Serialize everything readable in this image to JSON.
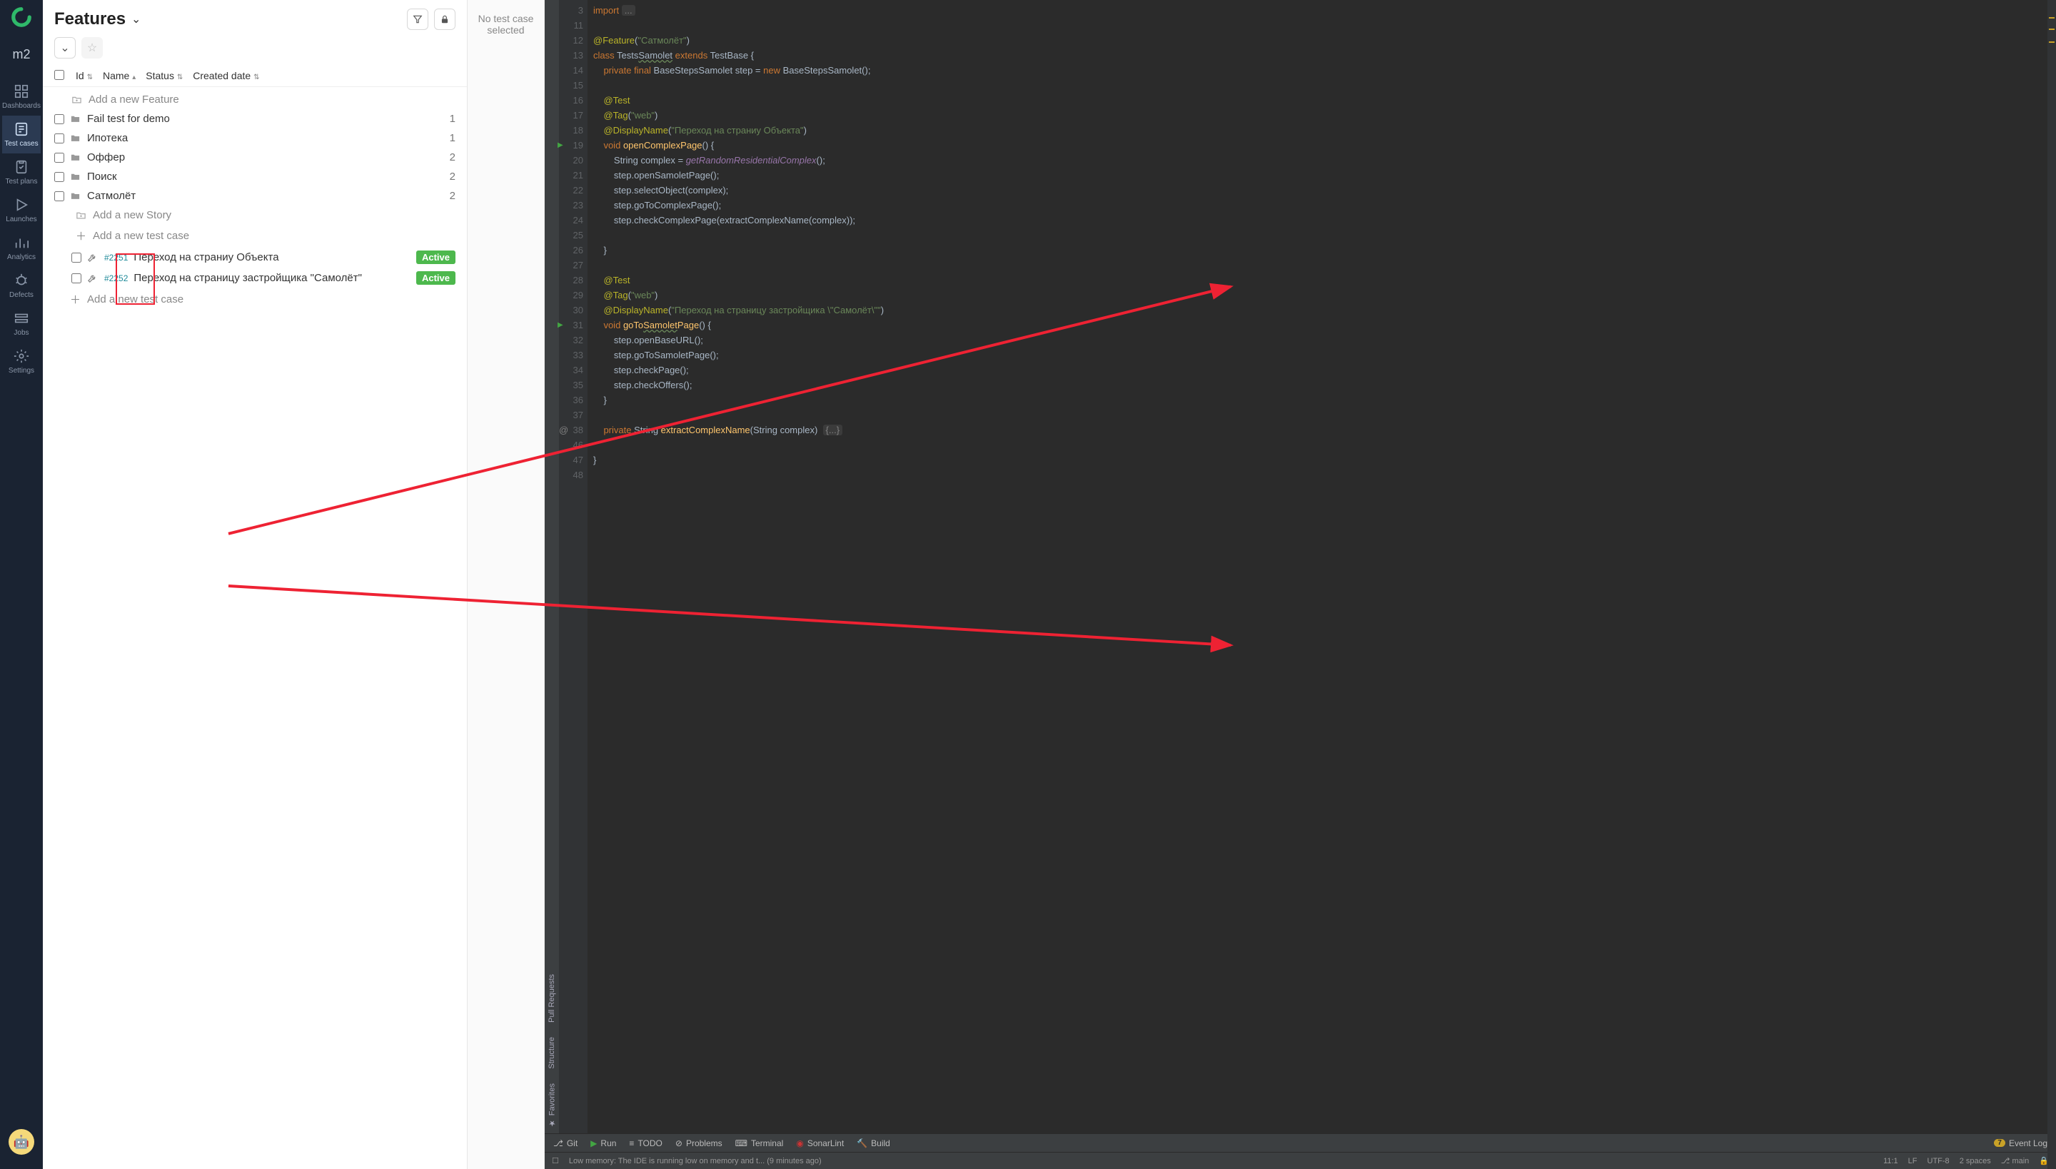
{
  "project": "m2",
  "nav": [
    {
      "key": "dashboards",
      "label": "Dashboards"
    },
    {
      "key": "testcases",
      "label": "Test cases"
    },
    {
      "key": "testplans",
      "label": "Test plans"
    },
    {
      "key": "launches",
      "label": "Launches"
    },
    {
      "key": "analytics",
      "label": "Analytics"
    },
    {
      "key": "defects",
      "label": "Defects"
    },
    {
      "key": "jobs",
      "label": "Jobs"
    },
    {
      "key": "settings",
      "label": "Settings"
    }
  ],
  "left_panel": {
    "title": "Features",
    "columns": {
      "id": "Id",
      "name": "Name",
      "status": "Status",
      "created": "Created date"
    },
    "add_feature": "Add a new Feature",
    "add_story": "Add a new Story",
    "add_testcase": "Add a new test case",
    "rows": [
      {
        "label": "Fail test for demo",
        "count": "1"
      },
      {
        "label": "Ипотека",
        "count": "1"
      },
      {
        "label": "Оффер",
        "count": "2"
      },
      {
        "label": "Поиск",
        "count": "2"
      },
      {
        "label": "Сатмолёт",
        "count": "2"
      }
    ],
    "testcases": [
      {
        "id": "#2251",
        "title": "Переход на страниу Объекта",
        "status": "Active"
      },
      {
        "id": "#2252",
        "title": "Переход на страницу застройщика \"Самолёт\"",
        "status": "Active"
      }
    ]
  },
  "mid_message": "No test case selected",
  "ide": {
    "left_tabs": {
      "pull": "Pull Requests",
      "structure": "Structure",
      "favorites": "Favorites"
    },
    "code_lines": [
      {
        "n": 3,
        "html": "<span class='tok-kw'>import</span> <span class='code-fold'>...</span>"
      },
      {
        "n": 11,
        "html": ""
      },
      {
        "n": 12,
        "html": "<span class='tok-ann'>@Feature</span>(<span class='tok-str'>\"Сатмолёт\"</span>)"
      },
      {
        "n": 13,
        "html": "<span class='tok-kw'>class</span> Tests<span style='text-decoration:underline wavy #6a8759'>Samolet</span> <span class='tok-kw'>extends</span> TestBase {"
      },
      {
        "n": 14,
        "html": "    <span class='tok-kw'>private final</span> BaseStepsSamolet step = <span class='tok-kw'>new</span> BaseStepsSamolet();"
      },
      {
        "n": 15,
        "html": ""
      },
      {
        "n": 16,
        "html": "    <span class='tok-ann'>@Test</span>"
      },
      {
        "n": 17,
        "html": "    <span class='tok-ann'>@Tag</span>(<span class='tok-str'>\"web\"</span>)"
      },
      {
        "n": 18,
        "html": "    <span class='tok-ann'>@DisplayName</span>(<span class='tok-str'>\"Переход на страниу Объекта\"</span>)"
      },
      {
        "n": 19,
        "html": "    <span class='tok-kw'>void</span> <span class='tok-fn'>openComplexPage</span>() {",
        "run": true
      },
      {
        "n": 20,
        "html": "        String complex = <span class='tok-ital'>getRandomResidentialComplex</span>();"
      },
      {
        "n": 21,
        "html": "        step.openSamoletPage();"
      },
      {
        "n": 22,
        "html": "        step.selectObject(complex);"
      },
      {
        "n": 23,
        "html": "        step.goToComplexPage();"
      },
      {
        "n": 24,
        "html": "        step.checkComplexPage(extractComplexName(complex));"
      },
      {
        "n": 25,
        "html": ""
      },
      {
        "n": 26,
        "html": "    }"
      },
      {
        "n": 27,
        "html": ""
      },
      {
        "n": 28,
        "html": "    <span class='tok-ann'>@Test</span>"
      },
      {
        "n": 29,
        "html": "    <span class='tok-ann'>@Tag</span>(<span class='tok-str'>\"web\"</span>)"
      },
      {
        "n": 30,
        "html": "    <span class='tok-ann'>@DisplayName</span>(<span class='tok-str'>\"Переход на страницу застройщика \\\"Самолёт\\\"\"</span>)"
      },
      {
        "n": 31,
        "html": "    <span class='tok-kw'>void</span> <span class='tok-fn'>goTo<span style='text-decoration:underline wavy #6a8759'>Samolet</span>Page</span>() {",
        "run": true
      },
      {
        "n": 32,
        "html": "        step.openBaseURL();"
      },
      {
        "n": 33,
        "html": "        step.goToSamoletPage();"
      },
      {
        "n": 34,
        "html": "        step.checkPage();"
      },
      {
        "n": 35,
        "html": "        step.checkOffers();"
      },
      {
        "n": 36,
        "html": "    }"
      },
      {
        "n": 37,
        "html": ""
      },
      {
        "n": 38,
        "html": "    <span class='tok-kw'>private</span> String <span class='tok-fn'>extractComplexName</span>(String complex)  <span class='code-fold'>{...}</span>",
        "at": true
      },
      {
        "n": 46,
        "html": ""
      },
      {
        "n": 47,
        "html": "}"
      },
      {
        "n": 48,
        "html": ""
      }
    ],
    "bottom_tabs": {
      "git": "Git",
      "run": "Run",
      "todo": "TODO",
      "problems": "Problems",
      "terminal": "Terminal",
      "sonar": "SonarLint",
      "build": "Build",
      "event_count": "7",
      "event": "Event Log"
    },
    "status": {
      "lowmem": "Low memory: The IDE is running low on memory and t... (9 minutes ago)",
      "pos": "11:1",
      "lf": "LF",
      "enc": "UTF-8",
      "indent": "2 spaces",
      "branch": "main"
    }
  }
}
